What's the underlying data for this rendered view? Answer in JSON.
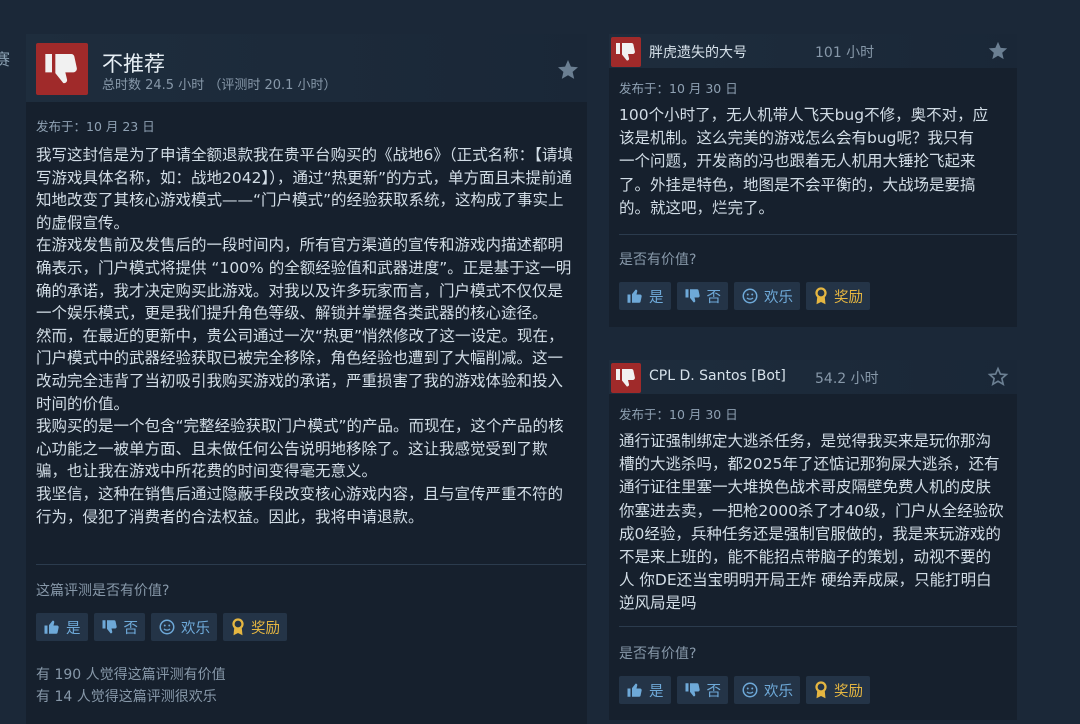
{
  "edge_text": "赛",
  "main_review": {
    "verdict": "不推荐",
    "hours": "总时数 24.5 小时 （评测时 20.1 小时）",
    "posted": "发布于：10 月 23 日",
    "paragraphs": [
      "我写这封信是为了申请全额退款我在贵平台购买的《战地6》（正式名称：【请填写游戏具体名称，如：战地2042】），通过“热更新”的方式，单方面且未提前通知地改变了其核心游戏模式——“门户模式”的经验获取系统，这构成了事实上的虚假宣传。",
      "在游戏发售前及发售后的一段时间内，所有官方渠道的宣传和游戏内描述都明确表示，门户模式将提供 “100% 的全额经验值和武器进度”。正是基于这一明确的承诺，我才决定购买此游戏。对我以及许多玩家而言，门户模式不仅仅是一个娱乐模式，更是我们提升角色等级、解锁并掌握各类武器的核心途径。",
      "然而，在最近的更新中，贵公司通过一次“热更”悄然修改了这一设定。现在，门户模式中的武器经验获取已被完全移除，角色经验也遭到了大幅削减。这一改动完全违背了当初吸引我购买游戏的承诺，严重损害了我的游戏体验和投入时间的价值。",
      "我购买的是一个包含“完整经验获取门户模式”的产品。而现在，这个产品的核心功能之一被单方面、且未做任何公告说明地移除了。这让我感觉受到了欺骗，也让我在游戏中所花费的时间变得毫无意义。",
      "我坚信，这种在销售后通过隐蔽手段改变核心游戏内容，且与宣传严重不符的行为，侵犯了消费者的合法权益。因此，我将申请退款。"
    ],
    "helpful_prompt": "这篇评测是否有价值?",
    "buttons": {
      "yes": "是",
      "no": "否",
      "funny": "欢乐",
      "award": "奖励"
    },
    "stat_helpful": "有 190 人觉得这篇评测有价值",
    "stat_funny": "有 14 人觉得这篇评测很欢乐"
  },
  "side_reviews": [
    {
      "author": "胖虎遗失的大号",
      "hours": "101 小时",
      "posted": "发布于：10 月 30 日",
      "paragraphs": [
        "100个小时了，无人机带人飞天bug不修，奥不对，应该是机制。这么完美的游戏怎么会有bug呢？我只有一个问题，开发商的冯也跟着无人机用大锤抡飞起来了。外挂是特色，地图是不会平衡的，大战场是要搞的。就这吧，烂完了。"
      ],
      "helpful_prompt": "是否有价值?",
      "buttons": {
        "yes": "是",
        "no": "否",
        "funny": "欢乐",
        "award": "奖励"
      }
    },
    {
      "author": "CPL D. Santos [Bot]",
      "hours": "54.2 小时",
      "posted": "发布于：10 月 30 日",
      "paragraphs": [
        "通行证强制绑定大逃杀任务，是觉得我买来是玩你那沟槽的大逃杀吗，都2025年了还惦记那狗屎大逃杀，还有通行证往里塞一大堆换色战术哥皮隔壁免费人机的皮肤你塞进去卖，一把枪2000杀了才40级，门户从全经验砍成0经验，兵种任务还是强制官服做的，我是来玩游戏的不是来上班的，能不能招点带脑子的策划，动视不要的人 你DE还当宝明明开局王炸 硬给弄成屎，只能打明白逆风局是吗"
      ],
      "helpful_prompt": "是否有价值?",
      "buttons": {
        "yes": "是",
        "no": "否",
        "funny": "欢乐",
        "award": "奖励"
      }
    }
  ],
  "colors": {
    "background": "#1b2838",
    "panel": "#16202d",
    "thumb_red": "#a02a2a",
    "link_blue": "#6ea9d8",
    "award_gold": "#e5b641"
  },
  "icons": [
    "thumbs-down-icon",
    "star-icon",
    "thumbs-up-icon",
    "smiley-icon",
    "award-icon"
  ]
}
